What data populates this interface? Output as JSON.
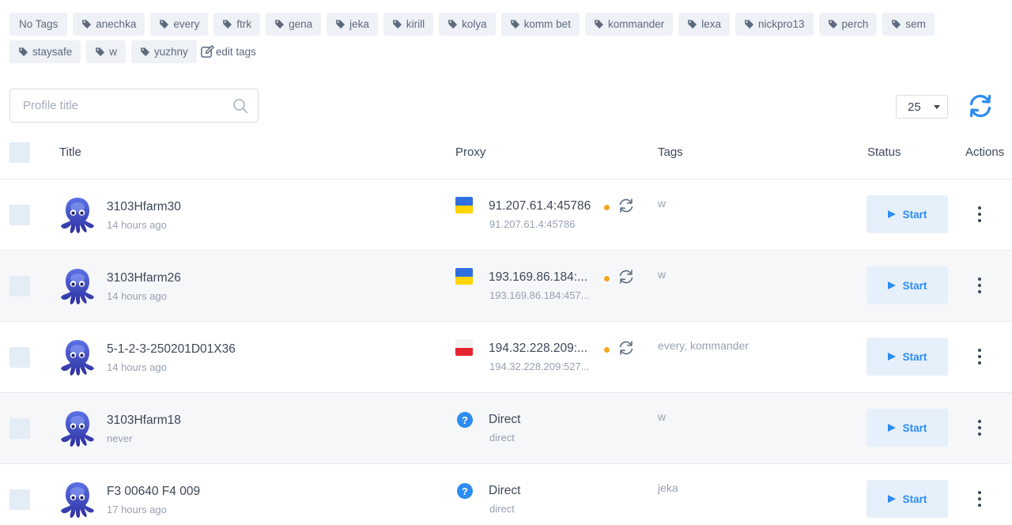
{
  "tags_bar": {
    "no_tags": "No Tags",
    "tags": [
      "anechka",
      "every",
      "ftrk",
      "gena",
      "jeka",
      "kirill",
      "kolya",
      "komm bet",
      "kommander",
      "lexa",
      "nickpro13",
      "perch",
      "sem",
      "staysafe",
      "w",
      "yuzhny"
    ],
    "edit_label": "edit tags"
  },
  "search": {
    "placeholder": "Profile title"
  },
  "page_size": "25",
  "columns": {
    "title": "Title",
    "proxy": "Proxy",
    "tags": "Tags",
    "status": "Status",
    "actions": "Actions"
  },
  "start_label": "Start",
  "colors": {
    "accent": "#2d8cf0",
    "status_dot": "#f5a623",
    "ua_blue": "#2f6fe0",
    "ua_yellow": "#ffd400",
    "ru_white": "#f2f2f2",
    "ru_red": "#e8232f"
  },
  "rows": [
    {
      "title": "3103Hfarm30",
      "time": "14 hours ago",
      "proxy_type": "flag",
      "flag": "ua",
      "proxy": "91.207.61.4:45786",
      "proxy_sub": "91.207.61.4:45786",
      "tags": "w"
    },
    {
      "title": "3103Hfarm26",
      "time": "14 hours ago",
      "proxy_type": "flag",
      "flag": "ua",
      "proxy": "193.169.86.184:...",
      "proxy_sub": "193.169.86.184:457...",
      "tags": "w"
    },
    {
      "title": "5-1-2-3-250201D01X36",
      "time": "14 hours ago",
      "proxy_type": "flag",
      "flag": "ru",
      "proxy": "194.32.228.209:...",
      "proxy_sub": "194.32.228.209:527...",
      "tags": "every, kommander"
    },
    {
      "title": "3103Hfarm18",
      "time": "never",
      "proxy_type": "direct",
      "proxy": "Direct",
      "proxy_sub": "direct",
      "tags": "w"
    },
    {
      "title": "F3 00640 F4 009",
      "time": "17 hours ago",
      "proxy_type": "direct",
      "proxy": "Direct",
      "proxy_sub": "direct",
      "tags": "jeka"
    }
  ]
}
